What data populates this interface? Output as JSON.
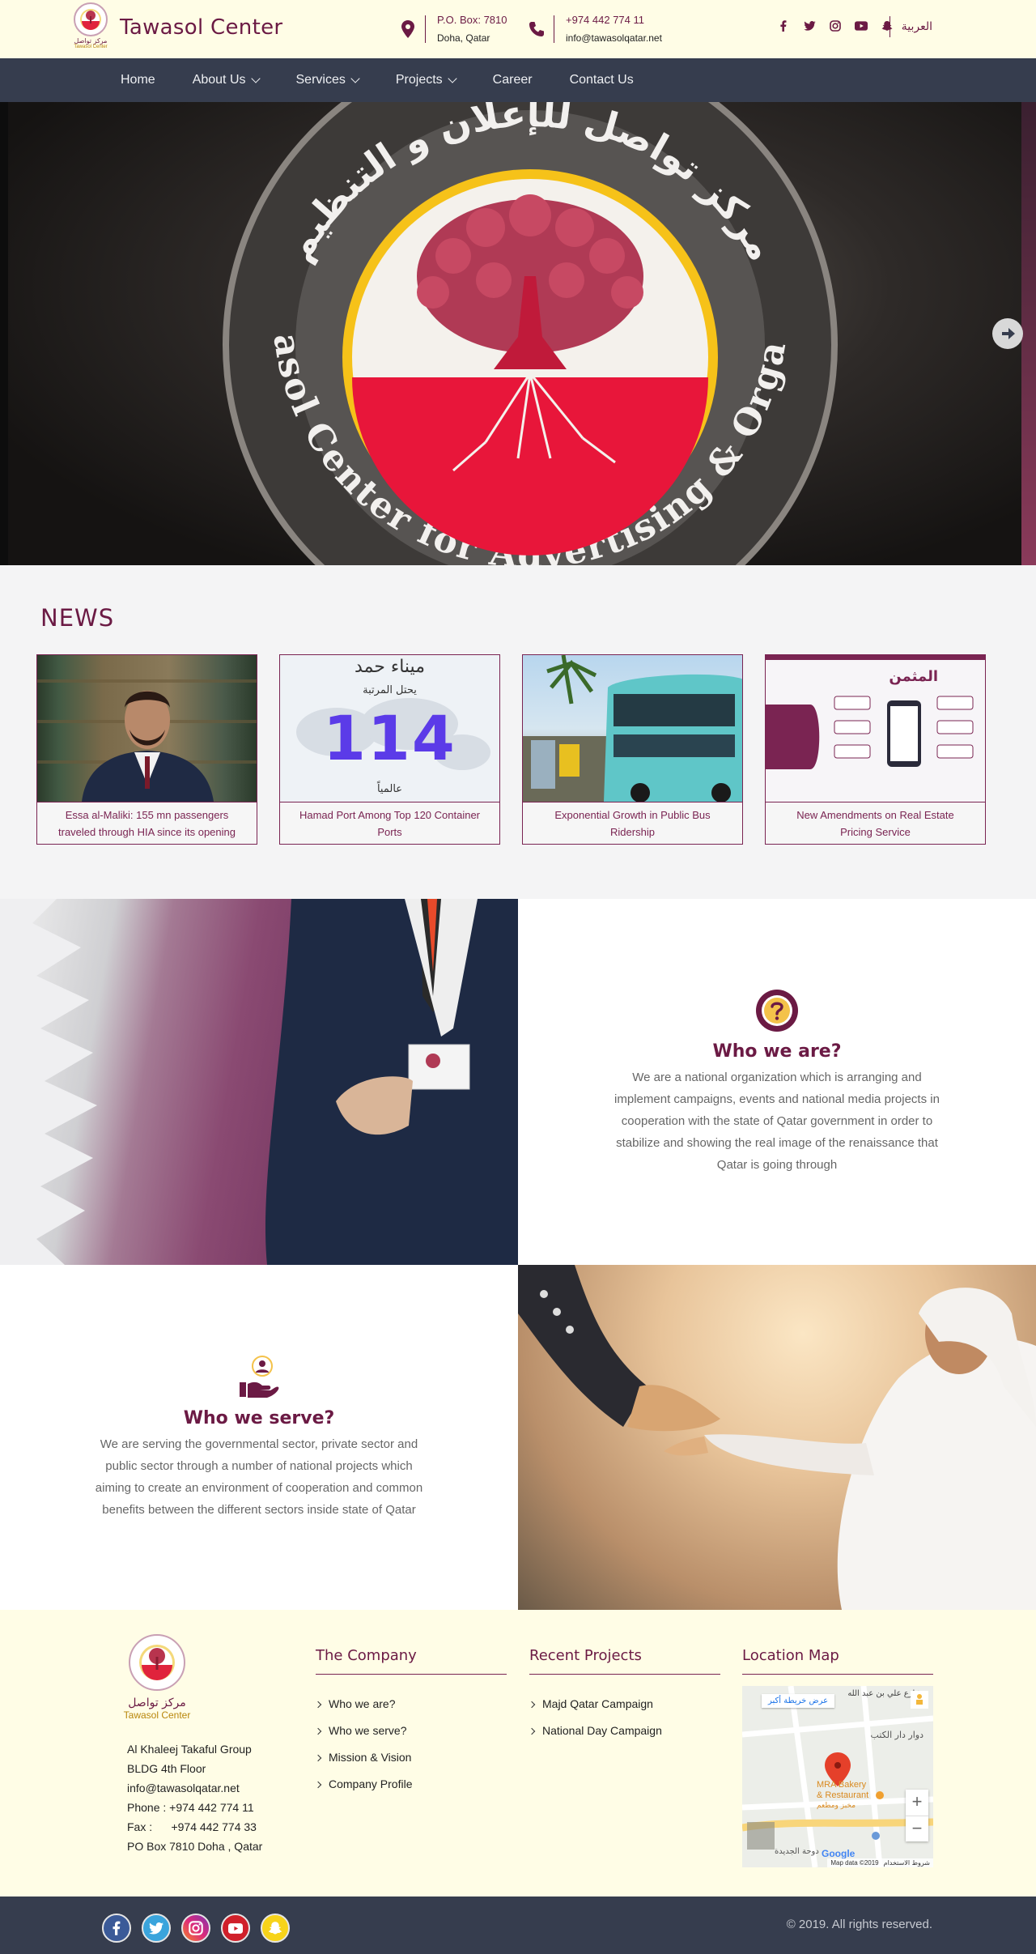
{
  "header": {
    "brand": "Tawasol Center",
    "logo_ar": "مركز تواصل",
    "logo_en": "Tawasol Center",
    "po_box": "P.O. Box: 7810",
    "city": "Doha, Qatar",
    "phone": "+974 442 774 11",
    "email": "info@tawasolqatar.net",
    "language": "العربية",
    "socials": [
      "facebook-icon",
      "twitter-icon",
      "instagram-icon",
      "youtube-icon",
      "snapchat-icon"
    ]
  },
  "nav": {
    "items": [
      {
        "label": "Home",
        "dropdown": false
      },
      {
        "label": "About Us",
        "dropdown": true
      },
      {
        "label": "Services",
        "dropdown": true
      },
      {
        "label": "Projects",
        "dropdown": true
      },
      {
        "label": "Career",
        "dropdown": false
      },
      {
        "label": "Contact Us",
        "dropdown": false
      }
    ]
  },
  "hero": {
    "ring_text_top_ar": "مركز تواصل للإعلان و التنظيم",
    "ring_text_bottom": "Tawasol Center for Advertising & Organize"
  },
  "news": {
    "title": "NEWS",
    "items": [
      {
        "caption": "Essa al-Maliki: 155 mn passengers traveled through HIA since its opening"
      },
      {
        "caption": "Hamad Port Among Top 120 Container Ports",
        "img_title": "ميناء حمد",
        "img_sub": "يحتل المرتبة",
        "img_number": "114",
        "img_bottom": "عالمياً"
      },
      {
        "caption": "Exponential Growth in Public Bus Ridership"
      },
      {
        "caption": "New Amendments on Real Estate Pricing Service",
        "img_title": "المثمن"
      }
    ]
  },
  "who_we_are": {
    "title": "Who we are?",
    "text": "We are a national organization which is arranging and implement campaigns, events and national media projects in cooperation with the state of Qatar government in order to stabilize and showing the real image of the renaissance that Qatar is going through"
  },
  "who_we_serve": {
    "title": "Who we serve?",
    "text": "We are serving the governmental sector, private sector and public sector through a number of national projects which aiming to create an environment of cooperation and common benefits between the different sectors inside state of Qatar"
  },
  "footer": {
    "logo_ar": "مركز تواصل",
    "logo_en": "Tawasol Center",
    "address": [
      "Al Khaleej Takaful Group",
      "BLDG 4th Floor",
      "info@tawasolqatar.net",
      "Phone : +974 442 774 11",
      "Fax :      +974 442 774 33",
      "PO Box 7810 Doha , Qatar"
    ],
    "company": {
      "title": "The Company",
      "links": [
        "Who we are?",
        "Who we serve?",
        "Mission & Vision",
        "Company Profile"
      ]
    },
    "projects": {
      "title": "Recent Projects",
      "links": [
        "Majd Qatar Campaign",
        "National Day Campaign"
      ]
    },
    "map": {
      "title": "Location Map",
      "street_label": "شارع علي بن عبد الله",
      "large_map_link": "عرض خريطة أكبر",
      "place_label_1": "MRA Bakery",
      "place_label_2": "& Restaurant",
      "place_label_ar": "مخبز ومطعم",
      "google": "Google",
      "map_data": "Map data ©2019",
      "terms": "شروط الاستخدام",
      "area_label": "دوحة الجديدة",
      "road_label": "دوار دار الكتب",
      "zoom_in": "+",
      "zoom_out": "−"
    }
  },
  "bottom": {
    "socials": [
      "facebook-icon",
      "twitter-icon",
      "instagram-icon",
      "youtube-icon",
      "snapchat-icon"
    ],
    "copyright": "© 2019. All rights reserved."
  },
  "colors": {
    "brand": "#6b1a44",
    "top_bg": "#fffde6",
    "nav_bg": "#363d4e"
  }
}
